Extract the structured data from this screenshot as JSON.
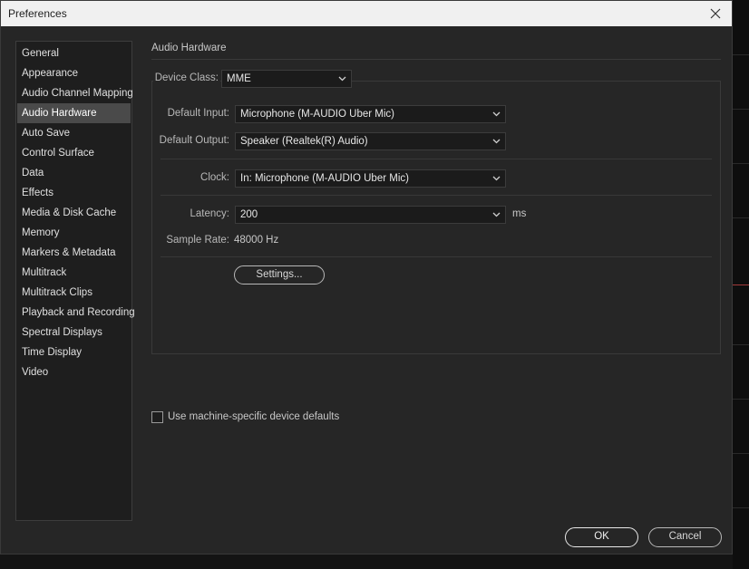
{
  "window": {
    "title": "Preferences"
  },
  "sidebar": {
    "items": [
      {
        "label": "General"
      },
      {
        "label": "Appearance"
      },
      {
        "label": "Audio Channel Mapping"
      },
      {
        "label": "Audio Hardware",
        "selected": true
      },
      {
        "label": "Auto Save"
      },
      {
        "label": "Control Surface"
      },
      {
        "label": "Data"
      },
      {
        "label": "Effects"
      },
      {
        "label": "Media & Disk Cache"
      },
      {
        "label": "Memory"
      },
      {
        "label": "Markers & Metadata"
      },
      {
        "label": "Multitrack"
      },
      {
        "label": "Multitrack Clips"
      },
      {
        "label": "Playback and Recording"
      },
      {
        "label": "Spectral Displays"
      },
      {
        "label": "Time Display"
      },
      {
        "label": "Video"
      }
    ]
  },
  "content": {
    "section_title": "Audio Hardware",
    "device_class": {
      "label": "Device Class:",
      "value": "MME"
    },
    "default_input": {
      "label": "Default Input:",
      "value": "Microphone (M-AUDIO Uber Mic)"
    },
    "default_output": {
      "label": "Default Output:",
      "value": "Speaker (Realtek(R) Audio)"
    },
    "clock": {
      "label": "Clock:",
      "value": "In: Microphone (M-AUDIO Uber Mic)"
    },
    "latency": {
      "label": "Latency:",
      "value": "200",
      "unit": "ms"
    },
    "sample_rate": {
      "label": "Sample Rate:",
      "value": "48000 Hz"
    },
    "settings_button": "Settings...",
    "machine_defaults": {
      "label": "Use machine-specific device defaults",
      "checked": false
    }
  },
  "footer": {
    "ok": "OK",
    "cancel": "Cancel"
  },
  "colors": {
    "dialog_bg": "#262626",
    "sidebar_bg": "#1e1e1e",
    "selected_bg": "#4a4a4a",
    "titlebar_bg": "#f0f0f0"
  }
}
